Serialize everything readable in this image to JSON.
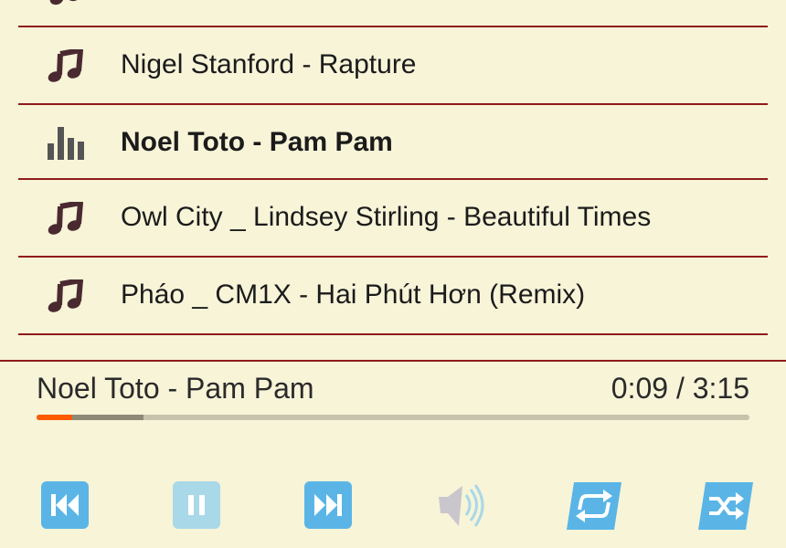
{
  "playlist": {
    "tracks": [
      {
        "title": "…",
        "state": "idle"
      },
      {
        "title": "Nigel Stanford - Rapture",
        "state": "idle"
      },
      {
        "title": "Noel Toto - Pam Pam",
        "state": "playing"
      },
      {
        "title": "Owl City _ Lindsey Stirling - Beautiful Times",
        "state": "idle"
      },
      {
        "title": "Pháo _ CM1X - Hai Phút Hơn (Remix)",
        "state": "idle"
      }
    ]
  },
  "now_playing": {
    "title": "Noel Toto - Pam Pam",
    "time": "0:09 / 3:15",
    "progress_fraction": 0.05,
    "buffered_fraction": 0.15
  },
  "controls": {
    "previous": {
      "icon": "skip-previous-icon"
    },
    "pause": {
      "icon": "pause-icon",
      "disabled": true
    },
    "next": {
      "icon": "skip-next-icon"
    },
    "volume": {
      "icon": "volume-icon",
      "disabled": true
    },
    "repeat": {
      "icon": "repeat-icon"
    },
    "shuffle": {
      "icon": "shuffle-icon"
    }
  },
  "colors": {
    "background": "#f7f4d8",
    "divider": "#8f1b1b",
    "note_icon": "#4a2a30",
    "equalizer_icon": "#555555",
    "button_blue": "#5ab5e6",
    "button_disabled": "#a9d8e8",
    "progress_played": "#ff5a00",
    "progress_buffered": "#8c8a77",
    "progress_track": "#c6c3ad"
  }
}
